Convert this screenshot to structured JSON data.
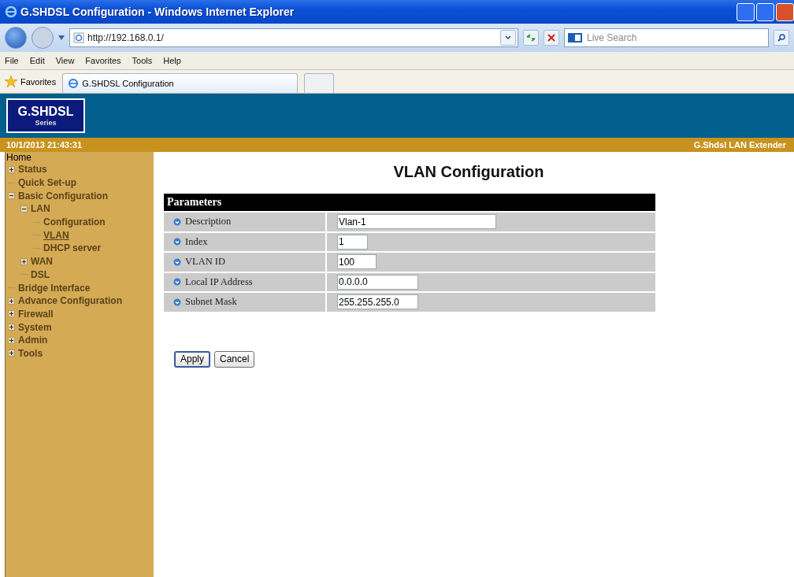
{
  "window": {
    "title": "G.SHDSL Configuration - Windows Internet Explorer"
  },
  "address_bar": {
    "value": "http://192.168.0.1/"
  },
  "search": {
    "placeholder": "Live Search"
  },
  "menu": [
    "File",
    "Edit",
    "View",
    "Favorites",
    "Tools",
    "Help"
  ],
  "favorites_bar": {
    "favorites": "Favorites",
    "tabs": [
      {
        "label": "G.SHDSL Configuration",
        "selected": true
      },
      {
        "selected": false
      }
    ]
  },
  "header": {
    "logo_title": "G.SHDSL",
    "logo_subtitle": "Series",
    "datetime": "10/1/2013 21:43:31",
    "product": "G.Shdsl LAN Extender"
  },
  "sidebar": {
    "home": "Home",
    "items": [
      {
        "label": "Status",
        "kind": "folder",
        "expanded": false,
        "selected": false
      },
      {
        "label": "Quick Set-up",
        "kind": "leaf",
        "selected": false
      },
      {
        "label": "Basic Configuration",
        "kind": "folder",
        "expanded": true,
        "selected": false,
        "children": [
          {
            "label": "LAN",
            "kind": "folder",
            "expanded": true,
            "selected": false,
            "children": [
              {
                "label": "Configuration",
                "kind": "leaf",
                "selected": false
              },
              {
                "label": "VLAN",
                "kind": "leaf",
                "selected": true
              },
              {
                "label": "DHCP server",
                "kind": "leaf",
                "selected": false
              }
            ]
          },
          {
            "label": "WAN",
            "kind": "folder",
            "expanded": false,
            "selected": false
          },
          {
            "label": "DSL",
            "kind": "leaf",
            "selected": false
          }
        ]
      },
      {
        "label": "Bridge Interface",
        "kind": "leaf",
        "selected": false
      },
      {
        "label": "Advance Configuration",
        "kind": "folder",
        "expanded": false,
        "selected": false
      },
      {
        "label": "Firewall",
        "kind": "folder",
        "expanded": false,
        "selected": false
      },
      {
        "label": "System",
        "kind": "folder",
        "expanded": false,
        "selected": false
      },
      {
        "label": "Admin",
        "kind": "folder",
        "expanded": false,
        "selected": false
      },
      {
        "label": "Tools",
        "kind": "folder",
        "expanded": false,
        "selected": false
      }
    ]
  },
  "page": {
    "title": "VLAN Configuration",
    "table_header": "Parameters",
    "rows": [
      {
        "label": "Description",
        "value": "Vlan-1"
      },
      {
        "label": "Index",
        "value": "1"
      },
      {
        "label": "VLAN ID",
        "value": "100"
      },
      {
        "label": "Local IP Address",
        "value": "0.0.0.0"
      },
      {
        "label": "Subnet Mask",
        "value": "255.255.255.0"
      }
    ],
    "buttons": [
      "Apply",
      "Cancel"
    ]
  }
}
